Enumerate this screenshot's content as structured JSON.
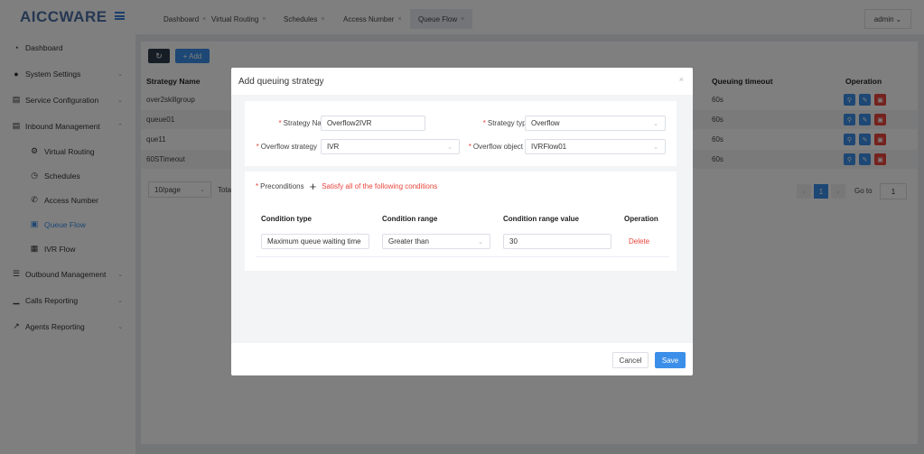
{
  "app": {
    "logo": "AICCWARE"
  },
  "tabs": [
    {
      "label": "Dashboard"
    },
    {
      "label": "Virtual Routing"
    },
    {
      "label": "Schedules"
    },
    {
      "label": "Access Number"
    },
    {
      "label": "Queue Flow"
    }
  ],
  "user": {
    "name": "admin"
  },
  "sidebar": {
    "items": [
      {
        "label": "Dashboard",
        "icon": "dashboard-icon"
      },
      {
        "label": "System Settings",
        "icon": "users-icon"
      },
      {
        "label": "Service Configuration",
        "icon": "config-icon"
      },
      {
        "label": "Inbound Management",
        "icon": "inbound-icon"
      },
      {
        "label": "Outbound Management",
        "icon": "outbound-icon"
      },
      {
        "label": "Calls Reporting",
        "icon": "bar-chart-icon"
      },
      {
        "label": "Agents Reporting",
        "icon": "line-chart-icon"
      }
    ],
    "subitems": [
      {
        "label": "Virtual Routing",
        "icon": "gear-icon"
      },
      {
        "label": "Schedules",
        "icon": "clock-icon"
      },
      {
        "label": "Access Number",
        "icon": "phone-icon"
      },
      {
        "label": "Queue Flow",
        "icon": "queue-icon",
        "active": true
      },
      {
        "label": "IVR Flow",
        "icon": "ivr-icon"
      }
    ]
  },
  "toolbar": {
    "add_label": "+ Add"
  },
  "table": {
    "columns": {
      "name": "Strategy Name",
      "timeout": "Queuing timeout",
      "operation": "Operation"
    },
    "rows": [
      {
        "name": "over2skillgroup",
        "timeout": "60s"
      },
      {
        "name": "queue01",
        "timeout": "60s"
      },
      {
        "name": "que11",
        "timeout": "60s"
      },
      {
        "name": "60STimeout",
        "timeout": "60s"
      }
    ]
  },
  "pager": {
    "size": "10/page",
    "total": "Total",
    "current": "1",
    "goto_label": "Go to",
    "goto_value": "1"
  },
  "modal": {
    "title": "Add queuing strategy",
    "strategy_name_label": "Strategy Name",
    "strategy_name_value": "Overflow2IVR",
    "strategy_type_label": "Strategy type",
    "strategy_type_value": "Overflow",
    "overflow_strategy_label": "Overflow strategy",
    "overflow_strategy_value": "IVR",
    "overflow_object_label": "Overflow object",
    "overflow_object_value": "IVRFlow01",
    "preconditions_label": "Preconditions",
    "preconditions_hint": "Satisfy all of the following conditions",
    "cond_cols": {
      "type": "Condition type",
      "range": "Condition range",
      "value": "Condition range value",
      "operation": "Operation"
    },
    "cond_row": {
      "type": "Maximum queue waiting time",
      "range": "Greater than",
      "value": "30",
      "delete": "Delete"
    },
    "cancel_label": "Cancel",
    "save_label": "Save"
  }
}
